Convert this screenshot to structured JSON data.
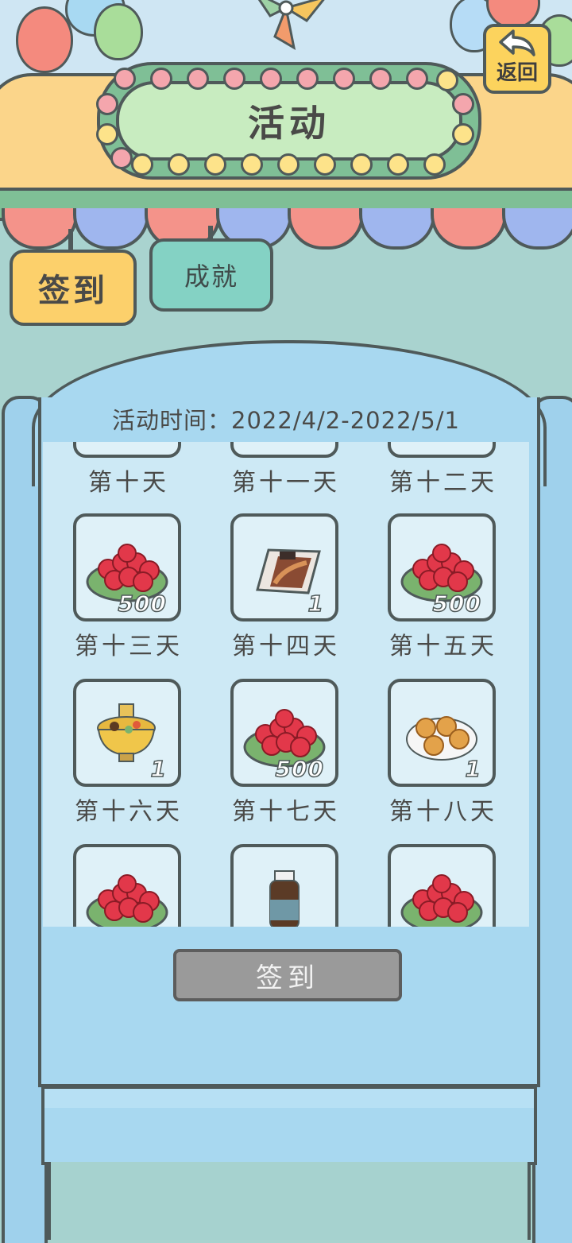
{
  "header": {
    "title": "活动",
    "back_label": "返回"
  },
  "tabs": [
    {
      "label": "签到",
      "active": true
    },
    {
      "label": "成就",
      "active": false
    }
  ],
  "event": {
    "time_text": "活动时间：2022/4/2-2022/5/1"
  },
  "rewards": [
    {
      "day": "第十天",
      "item_icon": "unknown-partial",
      "qty": ""
    },
    {
      "day": "第十一天",
      "item_icon": "unknown-partial",
      "qty": ""
    },
    {
      "day": "第十二天",
      "item_icon": "unknown-partial",
      "qty": ""
    },
    {
      "day": "第十三天",
      "item_icon": "clover-plate-icon",
      "qty": "500"
    },
    {
      "day": "第十四天",
      "item_icon": "smoked-fish-pack-icon",
      "qty": "1"
    },
    {
      "day": "第十五天",
      "item_icon": "clover-plate-icon",
      "qty": "500"
    },
    {
      "day": "第十六天",
      "item_icon": "hotpot-bowl-icon",
      "qty": "1"
    },
    {
      "day": "第十七天",
      "item_icon": "clover-plate-icon",
      "qty": "500"
    },
    {
      "day": "第十八天",
      "item_icon": "mooncake-plate-icon",
      "qty": "1"
    },
    {
      "day": "",
      "item_icon": "clover-plate-icon",
      "qty": ""
    },
    {
      "day": "",
      "item_icon": "bottle-jar-icon",
      "qty": ""
    },
    {
      "day": "",
      "item_icon": "clover-plate-icon",
      "qty": ""
    }
  ],
  "signin_button": {
    "label": "签到",
    "enabled": false
  },
  "colors": {
    "awning": "#fbd58a",
    "sign_inner": "#c8ecc0",
    "back_button": "#fcd35d",
    "tab_signin": "#fcd06b",
    "tab_achieve": "#84d2c4",
    "cabinet": "#a8d8f0",
    "button_disabled": "#9a9a9a"
  }
}
